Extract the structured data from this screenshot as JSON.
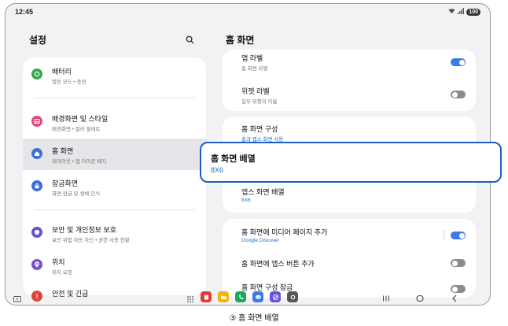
{
  "status": {
    "time": "12:45",
    "battery": "100"
  },
  "left": {
    "title": "설정",
    "items": [
      {
        "title": "배터리",
        "sub": "절전 모드 • 충전",
        "color": "#36a852"
      },
      {
        "title": "배경화면 및 스타일",
        "sub": "배경화면 • 컬러 팔레트",
        "color": "#e2497a"
      },
      {
        "title": "홈 화면",
        "sub": "레이아웃 • 앱 아이콘 배지",
        "color": "#3b6fd8"
      },
      {
        "title": "잠금화면",
        "sub": "화면 잠금 및 생체 인식",
        "color": "#3b6fd8"
      },
      {
        "title": "보안 및 개인정보 보호",
        "sub": "보안 위험 자동 차단 • 권한 사용 현황",
        "color": "#6a4fd8"
      },
      {
        "title": "위치",
        "sub": "위치 요청",
        "color": "#7a4fd0"
      },
      {
        "title": "안전 및 긴급",
        "sub": "",
        "color": "#e0453a"
      }
    ]
  },
  "right": {
    "title": "홈 화면",
    "rows": [
      {
        "title": "앱 라벨",
        "sub": "홈 화면 라벨"
      },
      {
        "title": "위젯 라벨",
        "sub": "일부 위젯의 이름"
      },
      {
        "title": "홈 화면 구성",
        "sub": "홈과 앱스 화면 사용"
      },
      {
        "title": "앱스 화면 배열",
        "sub": "8X6"
      },
      {
        "title": "홈 화면에 미디어 페이지 추가",
        "sub": "Google Discover"
      },
      {
        "title": "홈 화면에 앱스 버튼 추가",
        "sub": ""
      },
      {
        "title": "홈 화면 구성 잠금",
        "sub": ""
      }
    ]
  },
  "highlight": {
    "title": "홈 화면 배열",
    "value": "8X6"
  },
  "caption": "③ 홈 화면 배열"
}
